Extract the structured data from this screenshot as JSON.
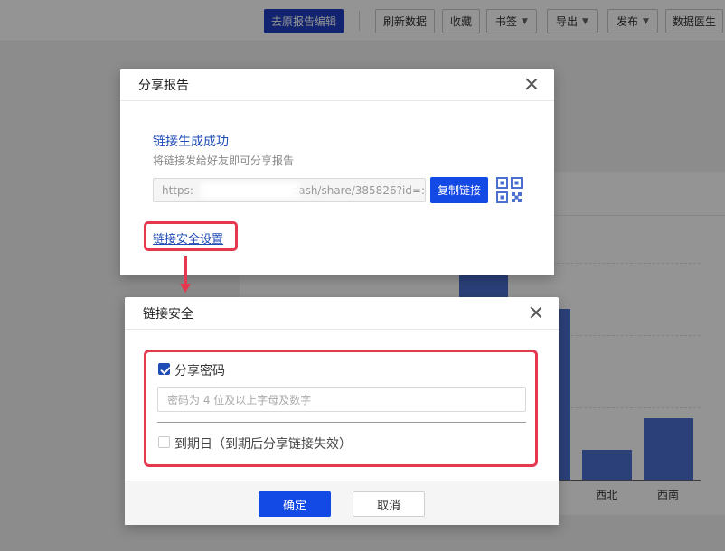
{
  "toolbar": {
    "edit_source_label": "去原报告编辑",
    "refresh_label": "刷新数据",
    "favorite_label": "收藏",
    "bookmark_label": "书签",
    "export_label": "导出",
    "publish_label": "发布",
    "data_doctor_label": "数据医生"
  },
  "chart": {
    "visible_categories": [
      "西北",
      "西南"
    ]
  },
  "share_dialog": {
    "title": "分享报告",
    "success_title": "链接生成成功",
    "success_subtitle": "将链接发给好友即可分享报告",
    "link_prefix": "https:",
    "link_suffix": "dash/share/385826?id=:",
    "copy_label": "复制链接",
    "security_link_label": "链接安全设置"
  },
  "security_dialog": {
    "title": "链接安全",
    "password_label": "分享密码",
    "password_checked": true,
    "password_placeholder": "密码为 4 位及以上字母及数字",
    "expiry_label": "到期日（到期后分享链接失效）",
    "expiry_checked": false,
    "ok_label": "确定",
    "cancel_label": "取消"
  },
  "colors": {
    "primary": "#1349e5",
    "highlight": "#e5384f",
    "bar": "#4a6fd1",
    "link": "#1f4cb5"
  }
}
